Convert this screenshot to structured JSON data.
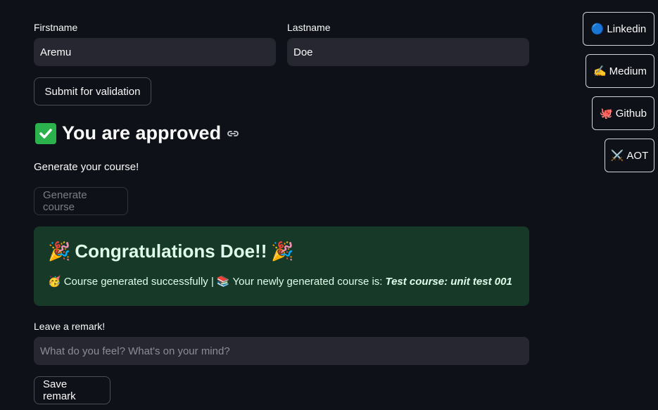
{
  "form": {
    "firstname_label": "Firstname",
    "firstname_value": "Aremu",
    "lastname_label": "Lastname",
    "lastname_value": "Doe",
    "submit_label": "Submit for validation"
  },
  "approval": {
    "title": "You are approved",
    "check_emoji": "✓"
  },
  "course": {
    "prompt": "Generate your course!",
    "generate_label": "Generate course"
  },
  "success": {
    "party_emoji": "🎉",
    "congrats_text": "Congratulations Doe!!",
    "face_emoji": "🥳",
    "generated_text": "Course generated successfully |",
    "books_emoji": "📚",
    "course_prefix": "Your newly generated course is:",
    "course_name": "Test course: unit test 001"
  },
  "remark": {
    "label": "Leave a remark!",
    "placeholder": "What do you feel? What's on your mind?",
    "save_label": "Save remark"
  },
  "sidebar": {
    "items": [
      {
        "emoji": "🔵",
        "label": "Linkedin"
      },
      {
        "emoji": "✍️",
        "label": "Medium"
      },
      {
        "emoji": "🐙",
        "label": "Github"
      },
      {
        "emoji": "⚔️",
        "label": "AOT"
      }
    ]
  },
  "colors": {
    "background": "#0e1117",
    "input_bg": "#262730",
    "success_bg": "#173928",
    "success_text": "#dffde9",
    "check_green": "#2bb24c"
  }
}
